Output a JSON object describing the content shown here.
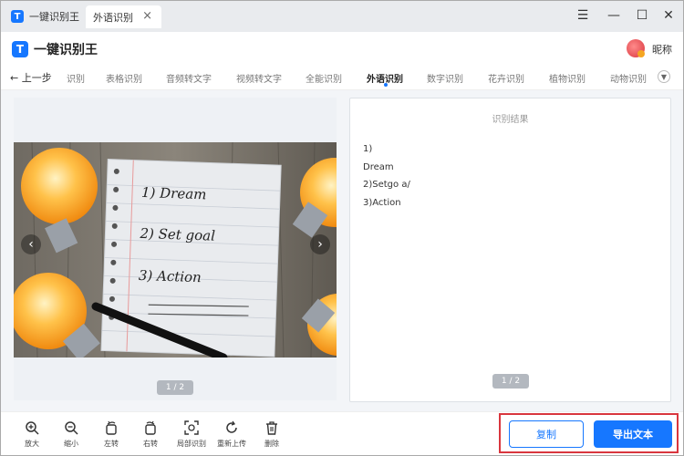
{
  "titlebar": {
    "app_name": "一键识别王",
    "logo_letter": "T",
    "tab_label": "外语识别",
    "tab_close": "×",
    "controls": [
      "☰",
      "—",
      "☐",
      "✕"
    ]
  },
  "header": {
    "title": "一键识别王",
    "logo_letter": "T",
    "nickname": "昵称"
  },
  "nav": {
    "back_label": "← 上一步",
    "items": [
      "识别",
      "表格识别",
      "音频转文字",
      "视频转文字",
      "全能识别",
      "外语识别",
      "数字识别",
      "花卉识别",
      "植物识别",
      "动物识别"
    ],
    "active_index": 5,
    "more_icon": "chevron-down-icon"
  },
  "image_panel": {
    "prev_arrow": "‹",
    "next_arrow": "›",
    "notepad_lines": [
      "1) Dream",
      "2) Set goal",
      "3) Action"
    ],
    "pager": "1 / 2"
  },
  "result_panel": {
    "title": "识别结果",
    "lines": [
      "1)",
      "Dream",
      "2)Setgo a/",
      "3)Action"
    ],
    "pager": "1 / 2"
  },
  "toolbar": {
    "tools": [
      {
        "label": "放大",
        "icon": "zoom-in-icon"
      },
      {
        "label": "缩小",
        "icon": "zoom-out-icon"
      },
      {
        "label": "左转",
        "icon": "rotate-left-icon"
      },
      {
        "label": "右转",
        "icon": "rotate-right-icon"
      },
      {
        "label": "局部识别",
        "icon": "partial-recognize-icon"
      },
      {
        "label": "重新上传",
        "icon": "reupload-icon"
      },
      {
        "label": "删除",
        "icon": "trash-icon"
      }
    ],
    "copy_label": "复制",
    "export_label": "导出文本"
  },
  "colors": {
    "accent": "#1677ff",
    "highlight": "#d9363e"
  }
}
